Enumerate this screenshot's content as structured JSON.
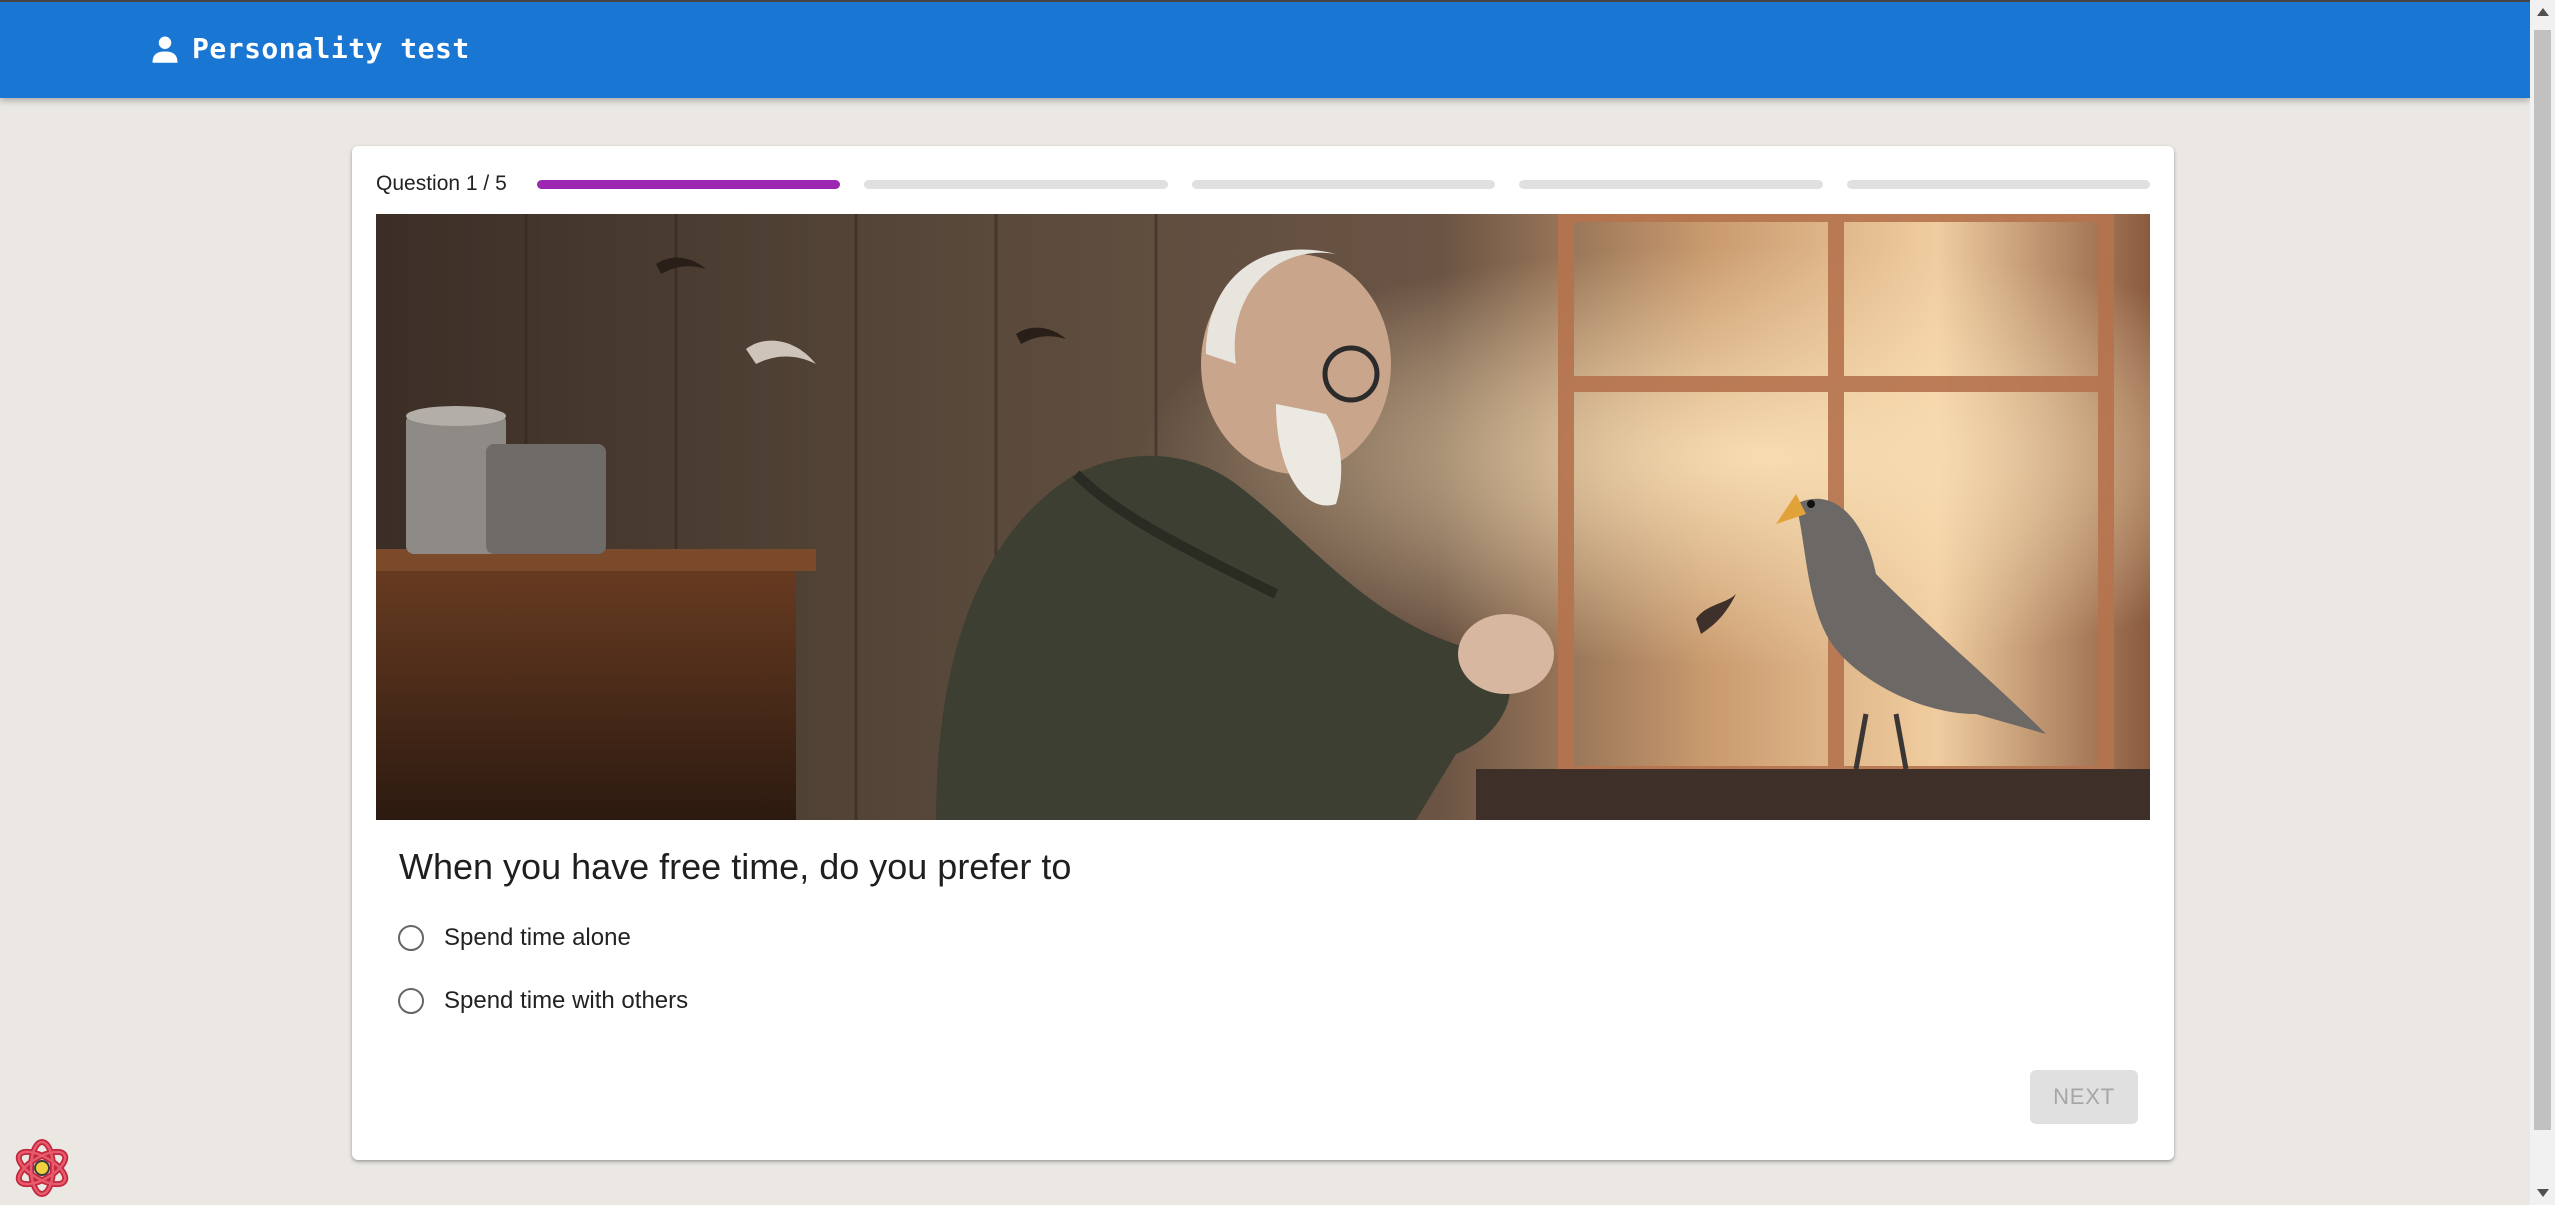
{
  "app": {
    "title": "Personality test",
    "icon": "person-icon"
  },
  "quiz": {
    "progress_label": "Question 1 / 5",
    "current_question": 1,
    "total_questions": 5,
    "question": "When you have free time, do you prefer to",
    "options": [
      {
        "label": "Spend time alone",
        "selected": false
      },
      {
        "label": "Spend time with others",
        "selected": false
      }
    ],
    "next_label": "NEXT",
    "next_enabled": false
  },
  "colors": {
    "appbar": "#1976d2",
    "progress_active": "#9c27b0",
    "progress_inactive": "#e0e0e0",
    "page_background": "#ebe8e4"
  }
}
